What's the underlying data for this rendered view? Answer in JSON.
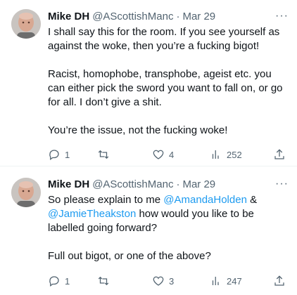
{
  "tweets": [
    {
      "author_name": "Mike DH",
      "author_handle": "@AScottishManc",
      "separator": "·",
      "date": "Mar 29",
      "more": "···",
      "text": [
        "I shall say this for the room. If you see yourself as against the woke, then you’re a fucking bigot!",
        "Racist, homophobe, transphobe, ageist etc. you can either pick the sword you want to fall on, or go for all. I don’t give a shit.",
        "You’re the issue, not the fucking woke!"
      ],
      "replies": "1",
      "retweets": "",
      "likes": "4",
      "views": "252"
    },
    {
      "author_name": "Mike DH",
      "author_handle": "@AScottishManc",
      "separator": "·",
      "date": "Mar 29",
      "more": "···",
      "text_parts": {
        "a": "So please explain to me ",
        "mention1": "@AmandaHolden",
        "b": " & ",
        "mention2": "@JamieTheakston",
        "c": " how would you like to be labelled going forward?",
        "p2": "Full out bigot, or one of the above?"
      },
      "replies": "1",
      "retweets": "",
      "likes": "3",
      "views": "247"
    }
  ],
  "icons": {
    "reply": "reply-icon",
    "retweet": "retweet-icon",
    "like": "heart-icon",
    "views": "views-icon",
    "share": "share-icon"
  },
  "colors": {
    "text": "#0f1419",
    "secondary": "#536471",
    "link": "#1d9bf0",
    "divider": "#eff3f4"
  }
}
